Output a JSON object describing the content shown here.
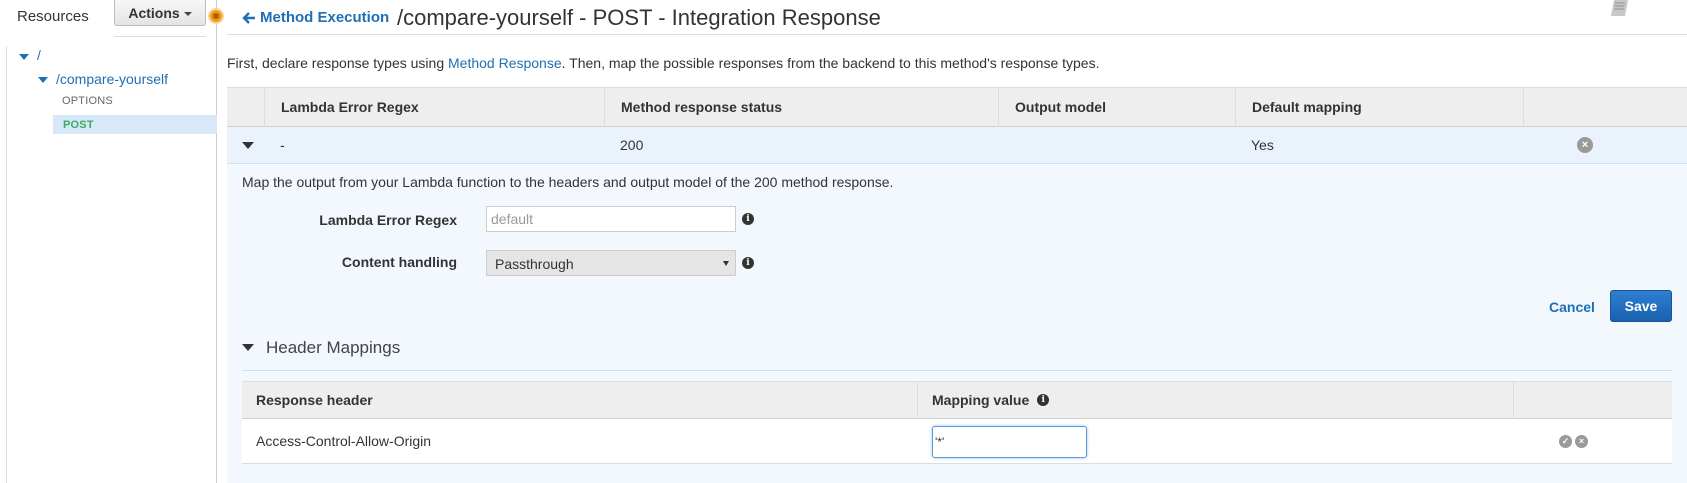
{
  "sidebar": {
    "resources_label": "Resources",
    "actions_label": "Actions",
    "tree": {
      "root": "/",
      "child": "/compare-yourself",
      "methods": [
        "OPTIONS",
        "POST"
      ]
    }
  },
  "header": {
    "back_label": "Method Execution",
    "title": "/compare-yourself - POST - Integration Response"
  },
  "intro": {
    "part1": "First, declare response types using ",
    "link": "Method Response",
    "part2": ". Then, map the possible responses from the backend to this method's response types."
  },
  "table": {
    "columns": [
      "Lambda Error Regex",
      "Method response status",
      "Output model",
      "Default mapping"
    ],
    "row": {
      "regex": "-",
      "status": "200",
      "output_model": "",
      "default_mapping": "Yes"
    }
  },
  "detail": {
    "description": "Map the output from your Lambda function to the headers and output model of the 200 method response.",
    "regex_label": "Lambda Error Regex",
    "regex_placeholder": "default",
    "content_handling_label": "Content handling",
    "content_handling_value": "Passthrough",
    "cancel_label": "Cancel",
    "save_label": "Save"
  },
  "header_mappings": {
    "title": "Header Mappings",
    "columns": [
      "Response header",
      "Mapping value"
    ],
    "rows": [
      {
        "header": "Access-Control-Allow-Origin",
        "value": "'*'"
      }
    ]
  },
  "colors": {
    "link": "#1f6fb5",
    "active_method": "#3aa864",
    "primary_button": "#1f6fc5",
    "expanded_bg": "#f2f8fd"
  }
}
